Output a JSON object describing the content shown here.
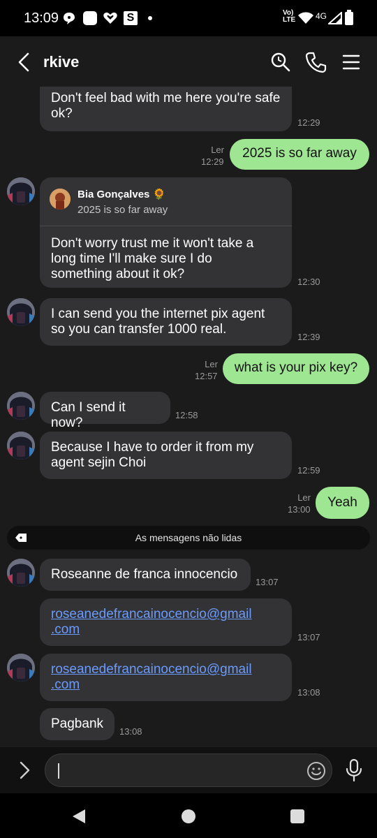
{
  "status_bar": {
    "time": "13:09",
    "network_label": "4G",
    "volte_label": "Vo) LTE",
    "s_badge": "S"
  },
  "header": {
    "title": "rkive",
    "icons": [
      "back-arrow-icon",
      "search-icon",
      "phone-icon",
      "menu-icon"
    ]
  },
  "messages": {
    "m1": {
      "text": "Don't feel bad with me here you're safe ok?",
      "time": "12:29"
    },
    "m2": {
      "text": "2025 is so far away",
      "read": "Ler",
      "time": "12:29"
    },
    "m3": {
      "reply_name": "Bia Gonçalves 🌻",
      "reply_text": "2025 is so far away",
      "text": "Don't worry trust me it won't take a long time I'll make sure I do something about it ok?",
      "time": "12:30"
    },
    "m4": {
      "text": "I can send you the internet pix agent so you can transfer 1000 real.",
      "time": "12:39"
    },
    "m5": {
      "text": "what is your pix key?",
      "read": "Ler",
      "time": "12:57"
    },
    "m6": {
      "text": "Can I send it now?",
      "time": "12:58"
    },
    "m7": {
      "text": "Because I have to order it from my agent sejin Choi",
      "time": "12:59"
    },
    "m8": {
      "text": "Yeah",
      "read": "Ler",
      "time": "13:00"
    },
    "unread_label": "As mensagens não lidas",
    "m9": {
      "text": "Roseanne de franca innocencio",
      "time": "13:07"
    },
    "m10": {
      "link_line1": "roseanedefrancainocencio@gmail",
      "link_line2": ".com",
      "time": "13:07"
    },
    "m11": {
      "link_line1": "roseanedefrancainocencio@gmail",
      "link_line2": ".com",
      "time": "13:08"
    },
    "m12": {
      "text": "Pagbank",
      "time": "13:08"
    }
  },
  "colors": {
    "background": "#1b1b1b",
    "incoming_bubble": "#333335",
    "outgoing_bubble": "#9fe693",
    "link": "#6a9bff"
  }
}
